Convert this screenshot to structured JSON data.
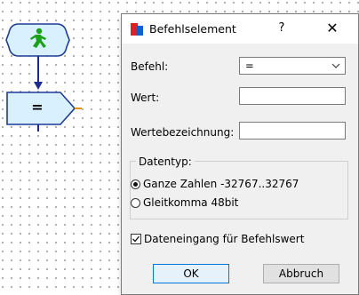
{
  "dialog": {
    "title": "Befehlselement",
    "help_label": "?",
    "close_label": "✕",
    "befehl_label": "Befehl:",
    "befehl_value": "=",
    "wert_label": "Wert:",
    "wert_value": "",
    "wertebezeichnung_label": "Wertebezeichnung:",
    "wertebezeichnung_value": "",
    "datentyp_label": "Datentyp:",
    "radio_int_label": "Ganze Zahlen -32767..32767",
    "radio_float_label": "Gleitkomma 48bit",
    "checkbox_label": "Dateneingang für Befehlswert",
    "ok_label": "OK",
    "cancel_label": "Abbruch"
  },
  "canvas": {
    "process_block_label": "="
  },
  "colors": {
    "flow_element_fill": "#d9f1ff",
    "flow_element_border": "#1e3c96",
    "start_icon_green": "#1aa01a",
    "arrow_blue": "#1e2a8c",
    "output_orange": "#f08c1e",
    "ok_button_border": "#0078d7"
  }
}
